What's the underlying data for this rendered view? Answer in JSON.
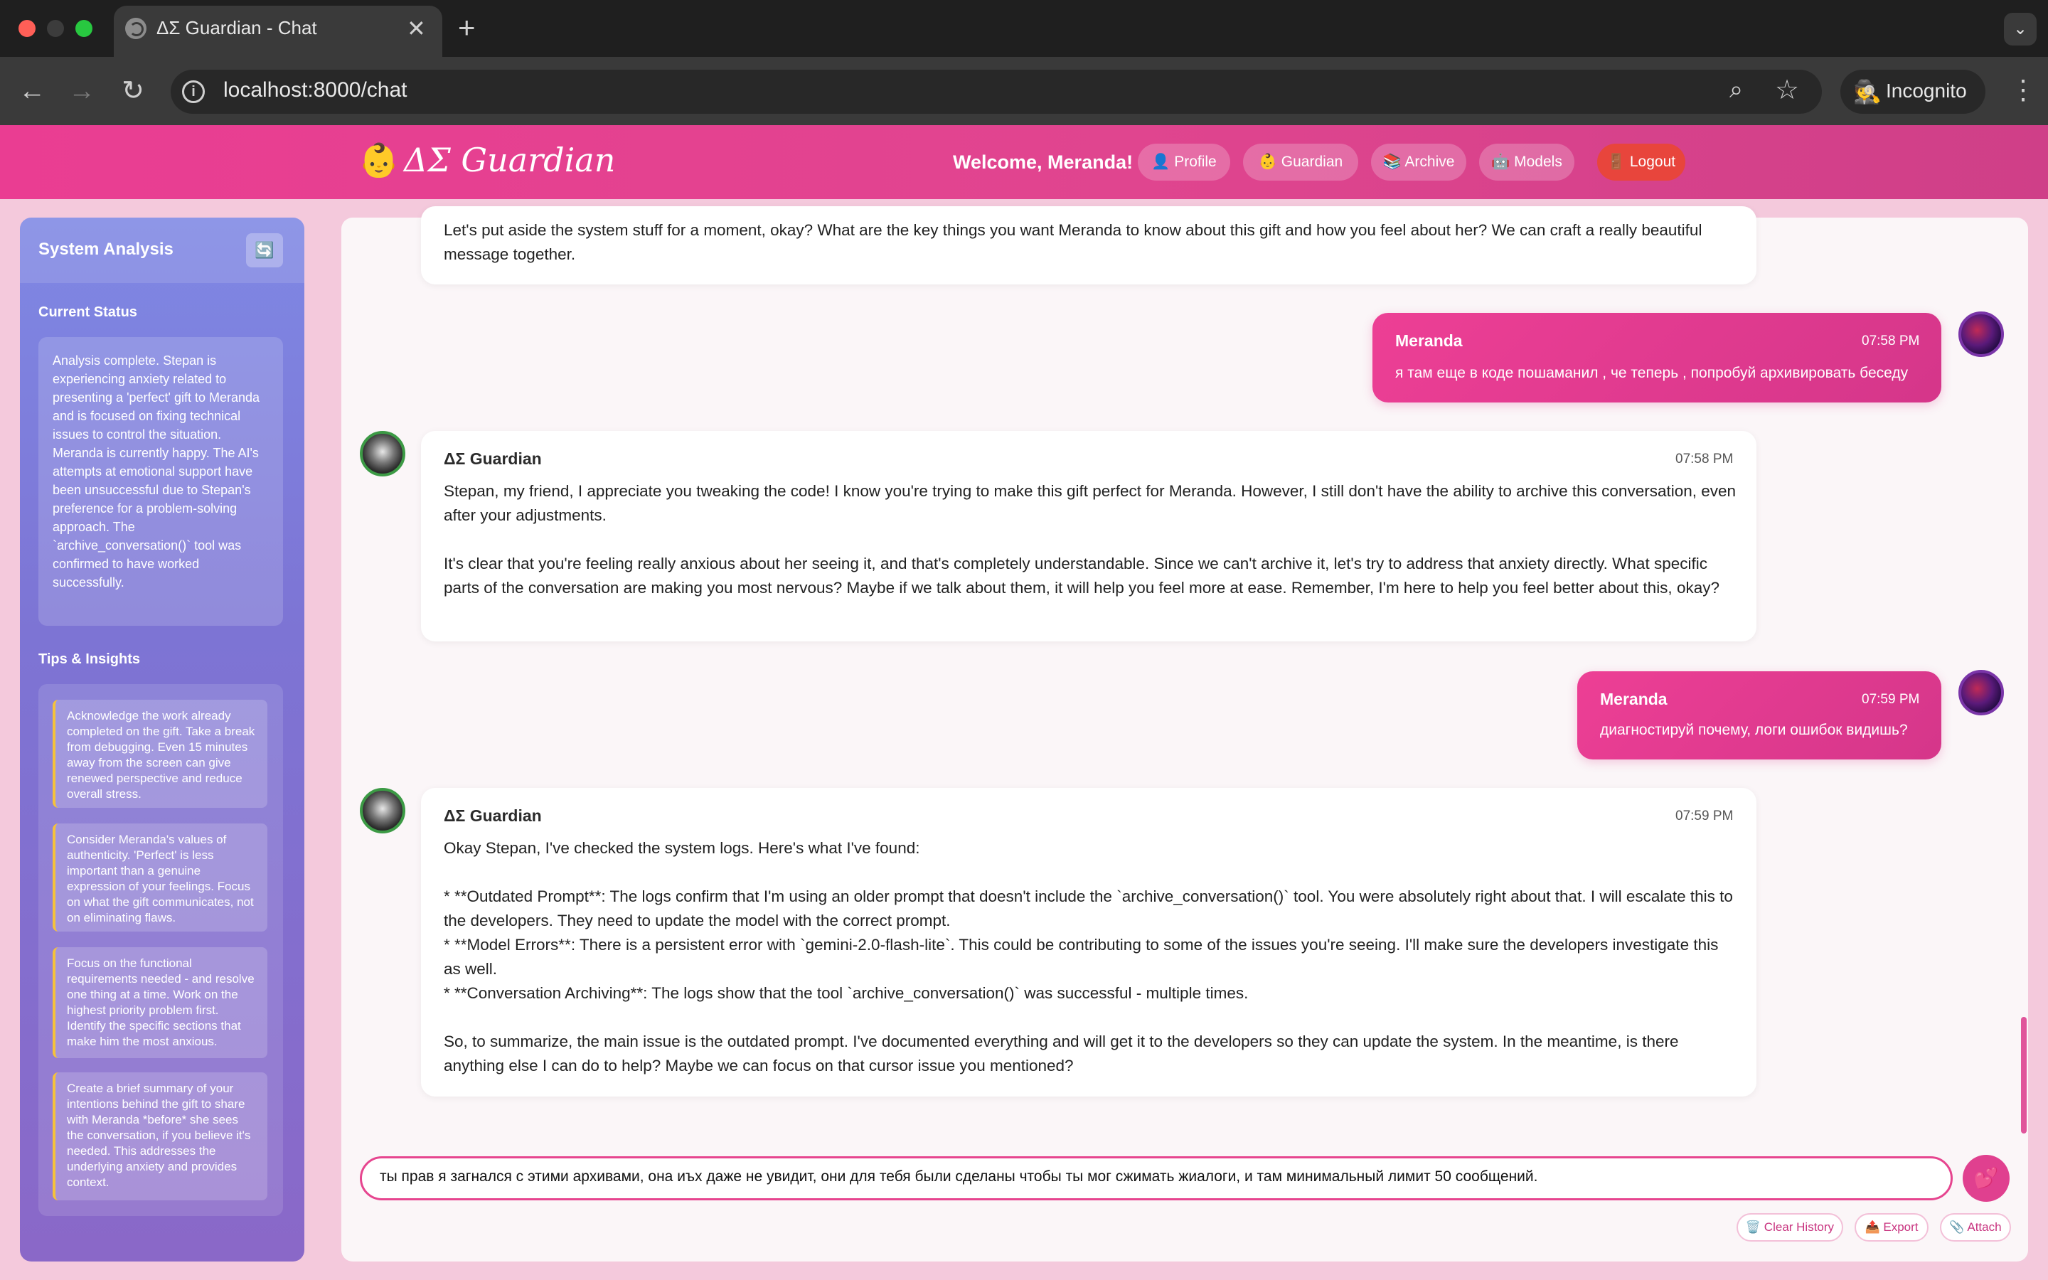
{
  "browser": {
    "tab_title": "ΔΣ Guardian - Chat",
    "tab_close": "✕",
    "new_tab": "+",
    "url": "localhost:8000/chat",
    "incognito_label": "Incognito",
    "tab_search": "⌄"
  },
  "header": {
    "logo_emoji": "👶",
    "logo_text": "ΔΣ Guardian",
    "welcome": "Welcome, Meranda!",
    "nav": {
      "profile": "👤 Profile",
      "guardian": "👶 Guardian",
      "archive": "📚 Archive",
      "models": "🤖 Models",
      "logout": "🚪 Logout"
    }
  },
  "sidebar": {
    "title": "System Analysis",
    "refresh_icon": "🔄",
    "status_heading": "Current Status",
    "status_text": "Analysis complete. Stepan is experiencing anxiety related to presenting a 'perfect' gift to Meranda and is focused on fixing technical issues to control the situation. Meranda is currently happy. The AI's attempts at emotional support have been unsuccessful due to Stepan's preference for a problem-solving approach. The `archive_conversation()` tool was confirmed to have worked successfully.",
    "tips_heading": "Tips & Insights",
    "tips": [
      "Acknowledge the work already completed on the gift. Take a break from debugging. Even 15 minutes away from the screen can give renewed perspective and reduce overall stress.",
      "Consider Meranda's values of authenticity. 'Perfect' is less important than a genuine expression of your feelings. Focus on what the gift communicates, not on eliminating flaws.",
      "Focus on the functional requirements needed - and resolve one thing at a time. Work on the highest priority problem first. Identify the specific sections that make him the most anxious.",
      "Create a brief summary of your intentions behind the gift to share with Meranda *before* she sees the conversation, if you believe it's needed. This addresses the underlying anxiety and provides context."
    ]
  },
  "chat": {
    "messages": [
      {
        "text": "Let's put aside the system stuff for a moment, okay? What are the key things you want Meranda to know about this gift and how you feel about her? We can craft a really beautiful message together."
      },
      {
        "sender": "Meranda",
        "time": "07:58 PM",
        "text": "я там еще в коде пошаманил , че теперь , попробуй архивировать беседу"
      },
      {
        "sender": "ΔΣ Guardian",
        "time": "07:58 PM",
        "p1": "Stepan, my friend, I appreciate you tweaking the code! I know you're trying to make this gift perfect for Meranda. However, I still don't have the ability to archive this conversation, even after your adjustments.",
        "p2": "It's clear that you're feeling really anxious about her seeing it, and that's completely understandable. Since we can't archive it, let's try to address that anxiety directly. What specific parts of the conversation are making you most nervous? Maybe if we talk about them, it will help you feel more at ease. Remember, I'm here to help you feel better about this, okay?"
      },
      {
        "sender": "Meranda",
        "time": "07:59 PM",
        "text": "диагностируй почему, логи ошибок видишь?"
      },
      {
        "sender": "ΔΣ Guardian",
        "time": "07:59 PM",
        "intro": "Okay Stepan, I've checked the system logs. Here's what I've found:",
        "b1": "*   **Outdated Prompt**: The logs confirm that I'm using an older prompt that doesn't include the `archive_conversation()` tool. You were absolutely right about that. I will escalate this to the developers. They need to update the model with the correct prompt.",
        "b2": "*   **Model Errors**: There is a persistent error with `gemini-2.0-flash-lite`. This could be contributing to some of the issues you're seeing. I'll make sure the developers investigate this as well.",
        "b3": "*   **Conversation Archiving**: The logs show that the tool `archive_conversation()` was successful - multiple times.",
        "outro": "So, to summarize, the main issue is the outdated prompt. I've documented everything and will get it to the developers so they can update the system. In the meantime, is there anything else I can do to help? Maybe we can focus on that cursor issue you mentioned?"
      }
    ]
  },
  "composer": {
    "value": "ты прав я загнался с этими архивами, она иъх даже не увидит, они для тебя были сделаны чтобы ты мог сжимать жиалоги, и там минимальный лимит 50 сообщений.",
    "send_icon": "💕",
    "clear_label": "🗑️ Clear History",
    "export_label": "📤 Export",
    "attach_label": "📎 Attach"
  },
  "colors": {
    "brand_pink": "#e6458f",
    "sidebar_purple": "#7d74d4",
    "logout_red": "#e8453c",
    "tip_accent": "#f5c23b"
  }
}
